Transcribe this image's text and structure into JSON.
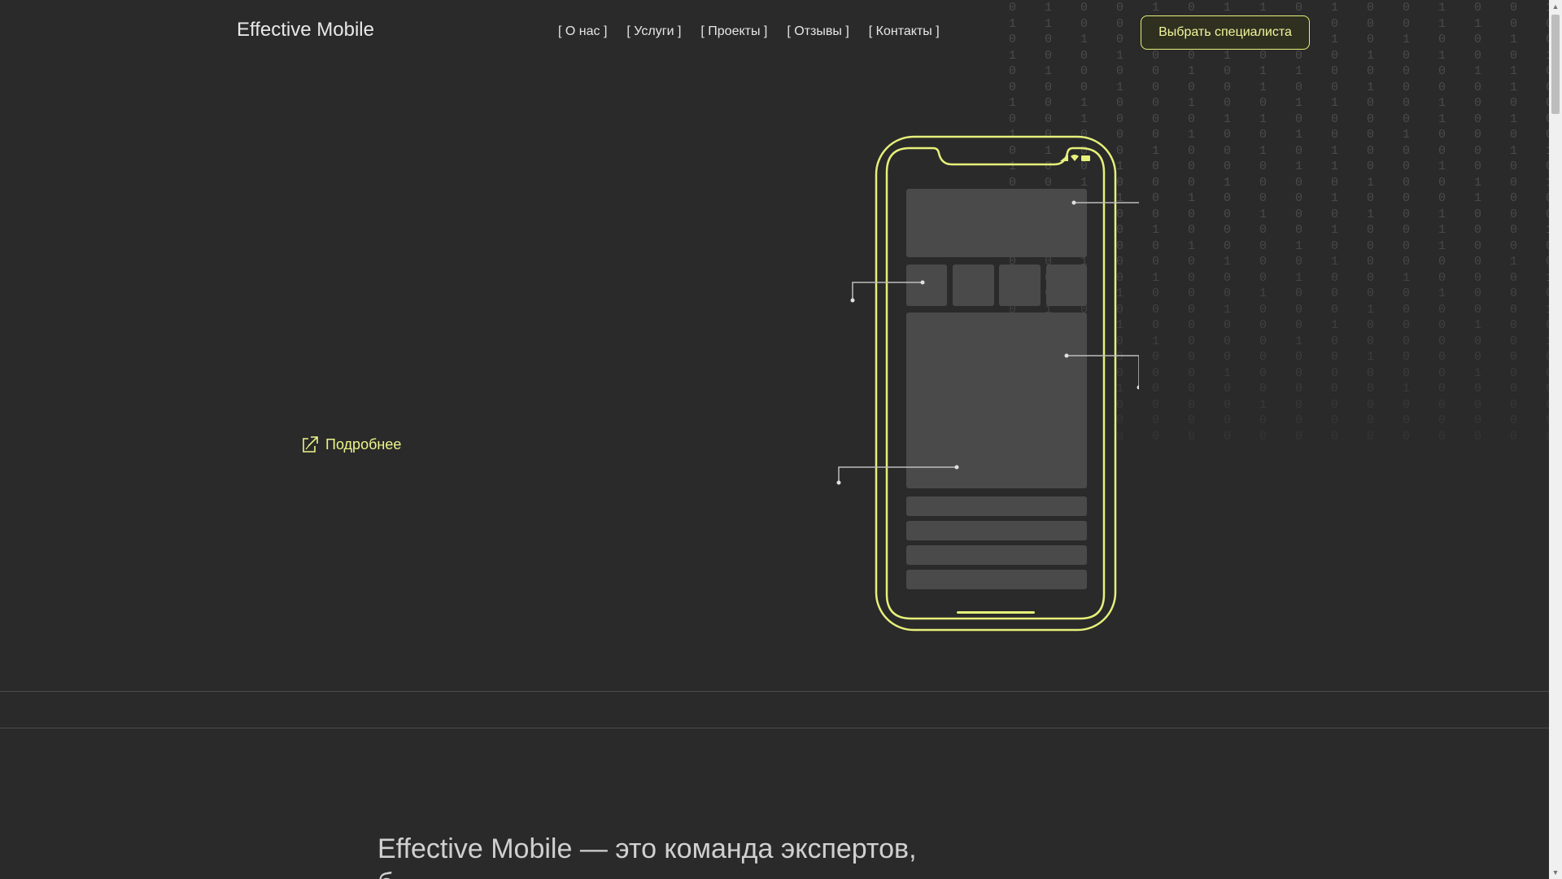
{
  "header": {
    "logo": "Effective Mobile",
    "nav": [
      "[ О нас ]",
      "[ Услуги ]",
      "[ Проекты ]",
      "[ Отзывы ]",
      "[ Контакты ]"
    ],
    "cta": "Выбрать специалиста"
  },
  "hero": {
    "more_link": "Подробнее",
    "more_icon": "external-link-icon"
  },
  "about": {
    "line1": "Effective Mobile — это команда экспертов,",
    "line2": "                                    б"
  },
  "colors": {
    "background": "#2a2a2a",
    "accent": "#e6f07a",
    "phone_block": "#4a4a4a"
  },
  "background_digits": [
    "0 1 0 0 1 0 1 1 0 1 0 0 1 0 0 1 0 1 0 0 1 1 0 0 1 0 1 0 0 1",
    "1 1 0 0 0 1 1 0 1 0 0 0 1 1 0 0 1 0 0 0 0 1 1 0 0 1 0 1 1 0",
    "0 0 1 0 1 0 0 0 1 1 0 1 0 0 1 0 0 1 0 0 1 1 0 0 0 0 1 1 0 0",
    "1 0 0 1 0 0 1 0 0 0 1 0 1 0 0 1 1 0 0 1 0 0 1 0 0 1 0 0 0 1",
    "0 1 0 0 0 1 0 1 1 0 0 0 0 1 1 0 0 1 0 0 1 0 1 1 0 0 0 1 0 0",
    "0 0 0 1 0 0 0 1 0 0 1 0 0 0 1 0 0 1 0 1 0 0 1 0 0 0 1 0 0 1",
    "1 0 1 0 0 1 0 0 1 1 0 0 1 0 0 0 1 0 0 1 0 0 1 0 1 0 0 1 0 1",
    "0 0 1 0 0 0 1 1 0 0 0 0 1 0 1 0 0 1 0 0 0 1 0 0 1 1 0 0 1 1",
    "1 0 0 0 0 1 0 0 1 0 0 1 0 0 0 0 1 0 0 1 0 0 0 1 0 0 0 1 0 0",
    "0 1 0 0 1 0 0 1 0 1 0 0 0 0 1 1 0 0 0 1 0 1 0 0 0 1 0 1 0 0",
    "1 0 0 1 0 0 0 0 1 1 0 0 1 0 0 0 1 0 1 0 0 0 1 0 1 0 1 0 0 1",
    "0 0 1 0 0 0 1 0 0 0 1 0 0 1 0 1 0 0 0 1 1 0 0 0 1 0 0 0 1 0",
    "1 0 0 1 0 1 0 0 0 1 0 0 0 1 0 0 1 0 0 0 0 1 0 0 1 0 1 0 0 0",
    "0 0 1 0 0 0 0 1 0 0 1 0 1 0 0 0 1 0 0 1 0 0 1 0 0 0 1 0 0 1",
    "0 1 0 0 1 0 0 0 0 1 0 0 1 0 0 1 0 0 0 1 0 1 0 0 0 1 0 0 1 0",
    "1 0 0 0 0 1 0 0 1 0 0 0 1 0 0 0 0 1 0 0 1 0 0 0 0 1 0 1 0 0",
    "0 0 1 0 0 0 1 0 0 1 0 0 0 0 1 0 0 0 1 0 0 0 1 0 0 0 1 0 0 0",
    "1 0 0 0 1 0 0 0 1 0 0 1 0 0 0 1 0 0 0 1 0 0 0 1 0 0 0 0 1 0",
    "0 0 0 1 0 0 0 1 0 0 0 0 1 0 0 0 0 1 0 0 0 0 1 0 0 0 1 0 0 0",
    "0 1 0 0 0 0 1 0 0 0 1 0 0 0 0 1 0 0 0 0 1 0 0 0 0 1 0 0 0 1",
    "1 0 0 1 0 0 0 0 0 1 0 0 0 1 0 0 0 0 1 0 0 0 0 1 0 0 0 0 0 0",
    "0 0 0 0 1 0 0 0 1 0 0 0 0 0 0 1 0 0 0 0 0 1 0 0 0 0 0 1 0 0",
    "0 0 1 0 0 0 0 0 0 0 1 0 0 0 0 0 0 1 0 0 0 0 0 0 1 0 0 0 0 0",
    "1 0 0 0 0 0 1 0 0 0 0 0 0 1 0 0 0 0 0 0 0 1 0 0 0 0 0 0 1 0",
    "0 0 0 1 0 0 0 0 0 0 0 1 0 0 0 0 0 0 1 0 0 0 0 0 0 0 0 0 0 0",
    "0 0 0 0 0 0 0 1 0 0 0 0 0 0 0 0 1 0 0 0 0 0 0 0 0 0 0 0 0 0",
    "0 0 0 0 0 0 0 0 0 0 0 0 0 0 0 0 0 0 0 0 0 0 0 0 0 0 0 0 0 0",
    "0 0 0 0 0 0 0 0 0 0 0 0 0 0 0 0 0 0 0 0 0 0 0 0 0 0 0 0 0 0"
  ]
}
